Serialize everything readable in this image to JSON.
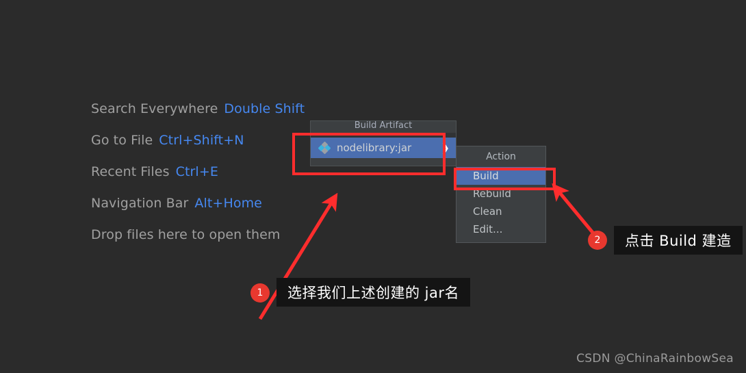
{
  "app": {
    "background_color": "#2b2b2b",
    "accent_selection_color": "#4b6eaf",
    "annotation_color": "#ff2d2d",
    "shortcut_key_color": "#4688f1"
  },
  "welcome_hints": [
    {
      "label": "Search Everywhere",
      "key": "Double Shift"
    },
    {
      "label": "Go to File",
      "key": "Ctrl+Shift+N"
    },
    {
      "label": "Recent Files",
      "key": "Ctrl+E"
    },
    {
      "label": "Navigation Bar",
      "key": "Alt+Home"
    },
    {
      "label": "Drop files here to open them",
      "key": ""
    }
  ],
  "artifact_popup": {
    "title": "Build Artifact",
    "item": {
      "label": "nodelibrary:jar",
      "icon": "artifact-diamond-icon",
      "submenu_arrow": "❯",
      "selected": true
    }
  },
  "action_menu": {
    "title": "Action",
    "items": [
      {
        "label": "Build",
        "selected": true
      },
      {
        "label": "Rebuild",
        "selected": false
      },
      {
        "label": "Clean",
        "selected": false
      },
      {
        "label": "Edit...",
        "selected": false
      }
    ]
  },
  "annotations": [
    {
      "number": "1",
      "text": "选择我们上述创建的 jar名"
    },
    {
      "number": "2",
      "text": "点击 Build 建造"
    }
  ],
  "watermark": "CSDN @ChinaRainbowSea"
}
